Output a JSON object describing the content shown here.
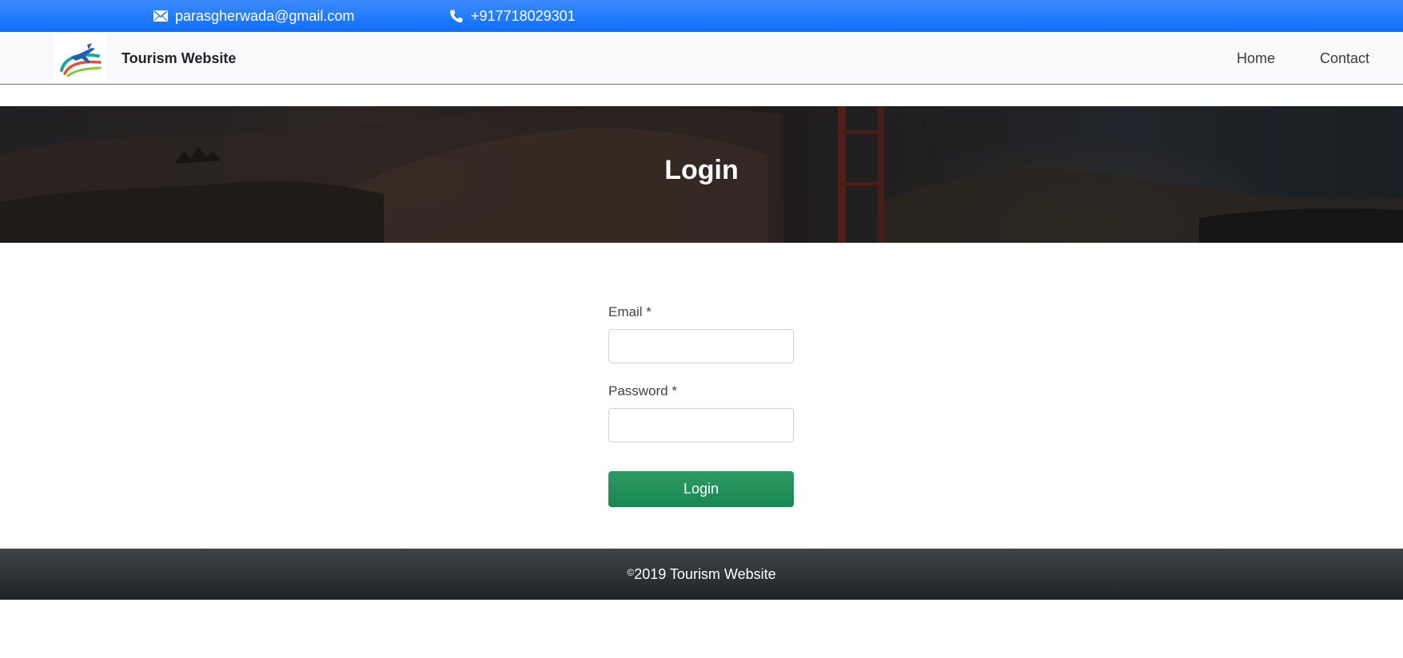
{
  "topbar": {
    "email": "parasgherwada@gmail.com",
    "email_icon": "envelope-icon",
    "phone": "+917718029301",
    "phone_icon": "phone-icon",
    "background": "#0d6efd"
  },
  "navbar": {
    "brand": "Tourism Website",
    "logo_icon": "airplane-logo",
    "links": [
      {
        "label": "Home"
      },
      {
        "label": "Contact"
      }
    ],
    "border_color": "#3f7fbf"
  },
  "hero": {
    "title": "Login"
  },
  "form": {
    "email_label": "Email *",
    "email_value": "",
    "password_label": "Password *",
    "password_value": "",
    "submit_label": "Login",
    "submit_color": "#198754"
  },
  "footer": {
    "copyright_symbol": "©",
    "text": "2019 Tourism Website"
  }
}
